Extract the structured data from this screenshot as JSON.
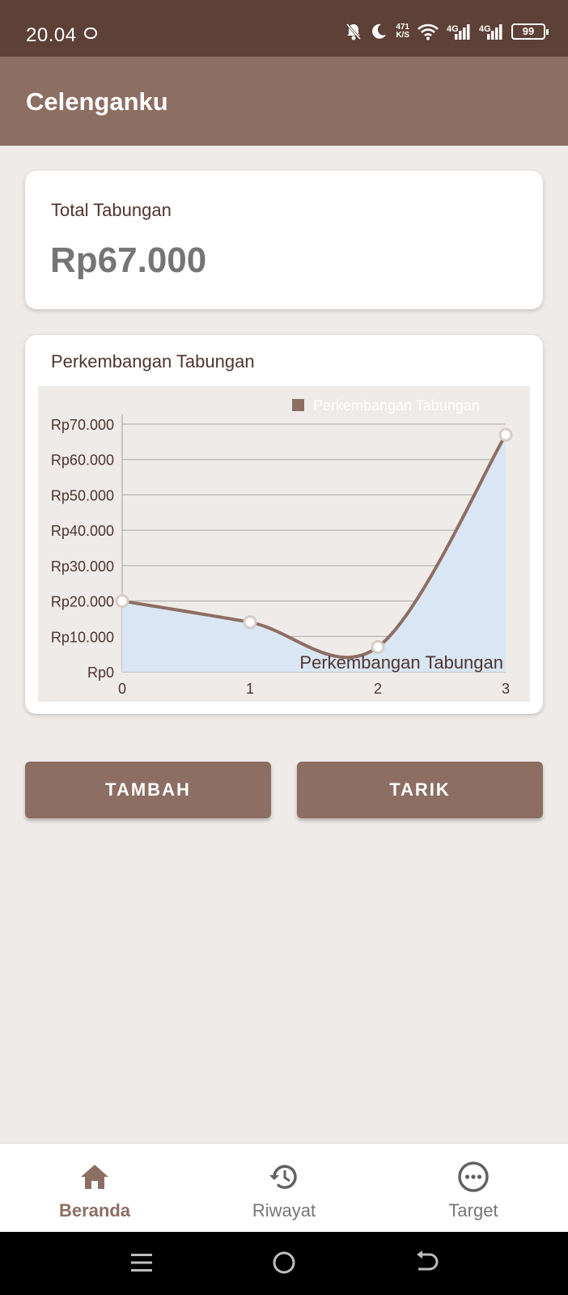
{
  "status_bar": {
    "time": "20.04",
    "net_speed_value": "471",
    "net_speed_unit": "K/S",
    "signal1": "4G",
    "signal2": "4G",
    "battery": "99"
  },
  "app_bar": {
    "title": "Celenganku"
  },
  "total_card": {
    "label": "Total Tabungan",
    "value": "Rp67.000"
  },
  "chart_card": {
    "title": "Perkembangan Tabungan"
  },
  "chart_data": {
    "type": "line",
    "x": [
      0,
      1,
      2,
      3
    ],
    "series": [
      {
        "name": "Perkembangan Tabungan",
        "values": [
          20000,
          14000,
          7000,
          67000
        ],
        "color": "#8d6e63",
        "fill": "#dae6f3"
      }
    ],
    "ylim": [
      0,
      70000
    ],
    "yticks": [
      0,
      10000,
      20000,
      30000,
      40000,
      50000,
      60000,
      70000
    ],
    "ytick_labels": [
      "Rp0",
      "Rp10.000",
      "Rp20.000",
      "Rp30.000",
      "Rp40.000",
      "Rp50.000",
      "Rp60.000",
      "Rp70.000"
    ],
    "xticks": [
      "0",
      "1",
      "2",
      "3"
    ],
    "legend": "top-right",
    "legend_label": "Perkembangan Tabungan",
    "description_label": "Perkembangan Tabungan",
    "grid": true,
    "smooth": true
  },
  "buttons": {
    "add": "TAMBAH",
    "withdraw": "TARIK"
  },
  "bottom_nav": {
    "items": [
      {
        "label": "Beranda",
        "icon": "home-icon",
        "active": true
      },
      {
        "label": "Riwayat",
        "icon": "history-icon",
        "active": false
      },
      {
        "label": "Target",
        "icon": "more-horiz-icon",
        "active": false
      }
    ]
  },
  "colors": {
    "primary_dark": "#5d4037",
    "primary": "#8d6e63",
    "background": "#efebe9",
    "inactive": "#757575"
  }
}
